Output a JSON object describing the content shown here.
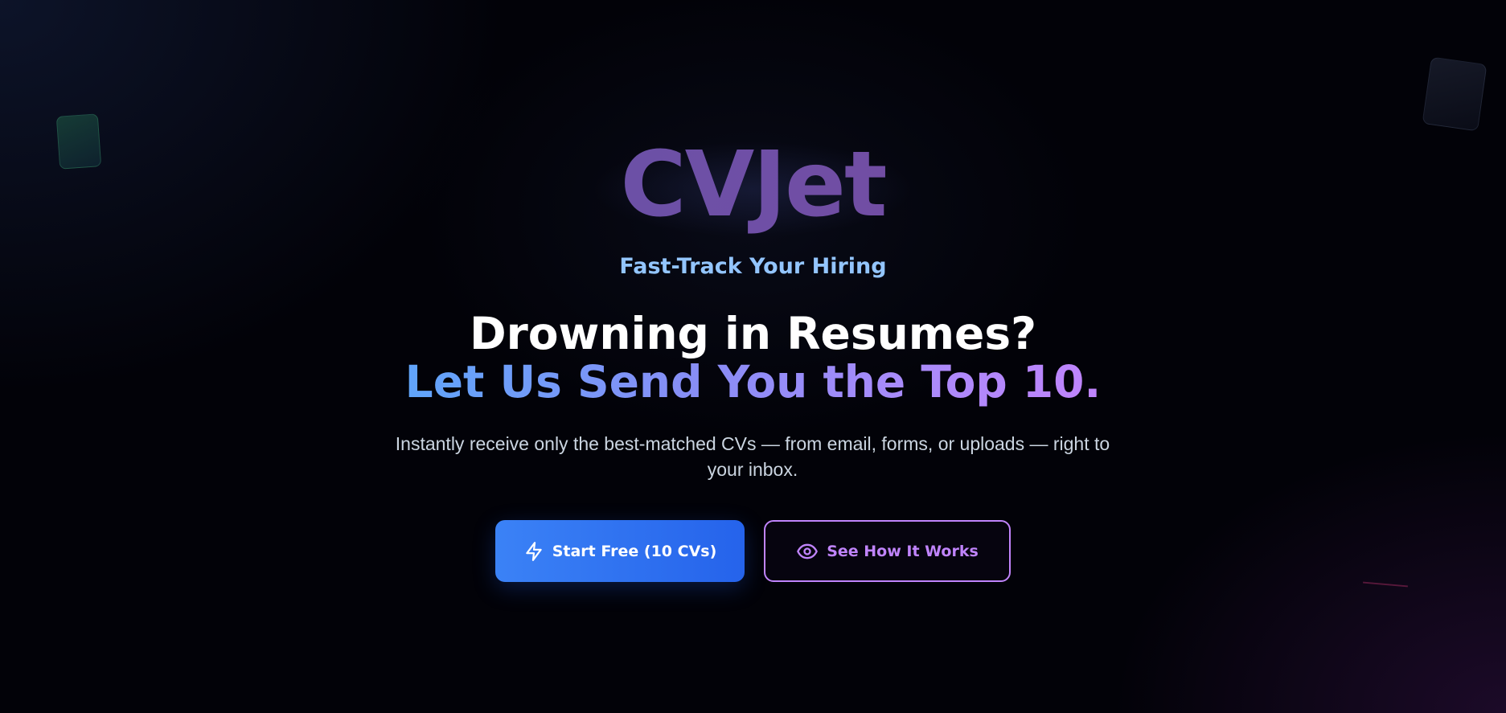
{
  "brand": {
    "logo_text": "CVJet",
    "tagline": "Fast-Track Your Hiring"
  },
  "hero": {
    "headline_line1": "Drowning in Resumes?",
    "headline_line2": "Let Us Send You the Top 10.",
    "subtext": "Instantly receive only the best-matched CVs — from email, forms, or uploads — right to your inbox."
  },
  "actions": {
    "primary": {
      "label": "Start Free (10 CVs)",
      "icon": "lightning-bolt-icon"
    },
    "secondary": {
      "label": "See How It Works",
      "icon": "eye-icon"
    }
  },
  "colors": {
    "tagline": "#93c5fd",
    "primary_button": "#3b82f6",
    "secondary_accent": "#c084fc",
    "headline_gradient_start": "#60a5fa",
    "headline_gradient_end": "#c084fc"
  }
}
